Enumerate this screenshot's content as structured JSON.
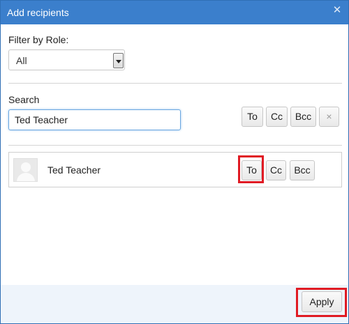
{
  "dialog": {
    "title": "Add recipients",
    "close_icon": "close-icon"
  },
  "filter": {
    "label": "Filter by Role:",
    "selected": "All"
  },
  "search": {
    "label": "Search",
    "value": "Ted Teacher",
    "buttons": {
      "to": "To",
      "cc": "Cc",
      "bcc": "Bcc",
      "clear_icon": "×"
    }
  },
  "results": [
    {
      "name": "Ted Teacher",
      "avatar": "avatar-placeholder-icon",
      "buttons": {
        "to": "To",
        "cc": "Cc",
        "bcc": "Bcc"
      }
    }
  ],
  "footer": {
    "apply_label": "Apply"
  },
  "colors": {
    "titlebar": "#3b7fcc",
    "highlight": "#e01b24",
    "footer": "#eef4fb"
  }
}
